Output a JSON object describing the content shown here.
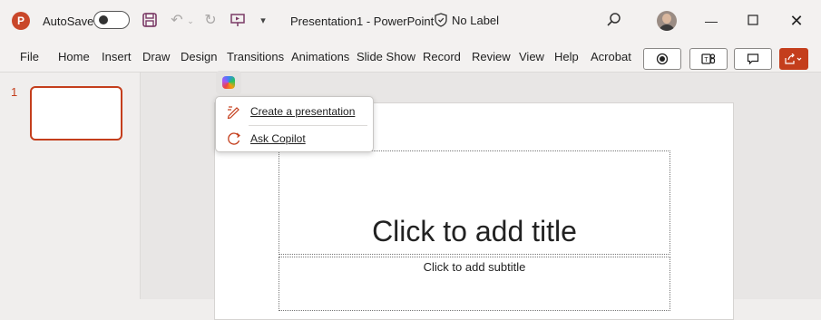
{
  "titlebar": {
    "app_logo": "P",
    "autosave_label": "AutoSave",
    "document_title": "Presentation1  -  PowerPoint",
    "sensitivity_label": "No Label"
  },
  "menu": {
    "tabs": [
      "File",
      "Home",
      "Insert",
      "Draw",
      "Design",
      "Transitions",
      "Animations",
      "Slide Show",
      "Record",
      "Review",
      "View",
      "Help",
      "Acrobat"
    ]
  },
  "thumbnails": {
    "slide_number": "1"
  },
  "slide": {
    "title_placeholder": "Click to add title",
    "subtitle_placeholder": "Click to add subtitle"
  },
  "copilot_menu": {
    "items": [
      {
        "label": "Create a presentation",
        "icon": "pen-sparkle-icon"
      },
      {
        "label": "Ask Copilot",
        "icon": "copilot-chat-icon"
      }
    ]
  },
  "colors": {
    "accent": "#c43e1c",
    "quick_access": "#7a3a66"
  }
}
